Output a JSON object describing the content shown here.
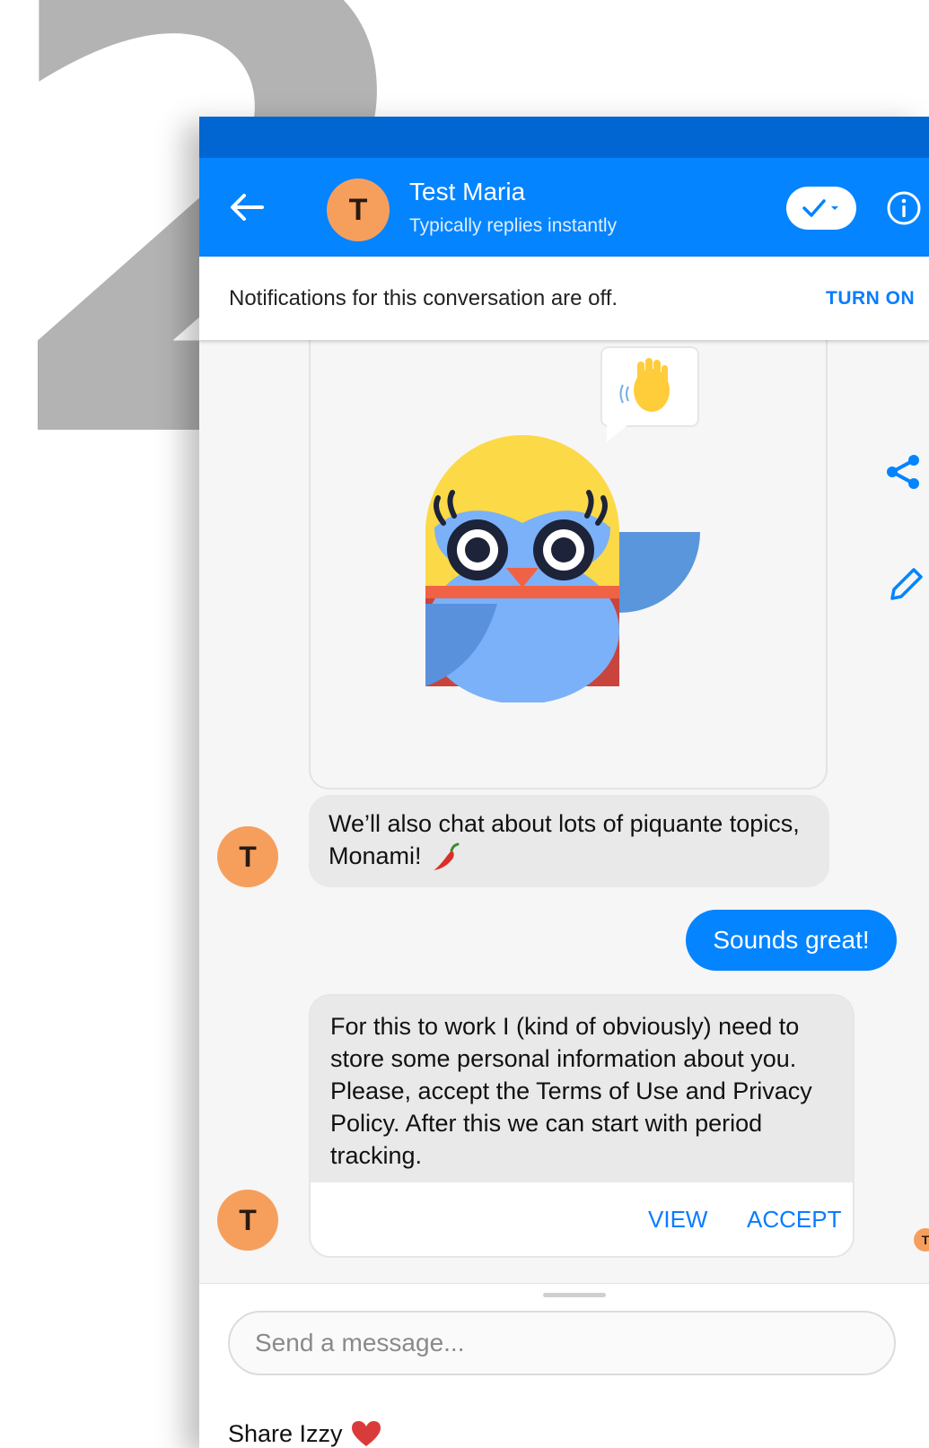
{
  "step_number": "2",
  "header": {
    "avatar_initial": "T",
    "title": "Test Maria",
    "subtitle": "Typically replies instantly"
  },
  "notification": {
    "text": "Notifications for this conversation are off.",
    "action": "TURN ON"
  },
  "messages": {
    "incoming_1": "We’ll also chat about lots of piquante topics, Monami!",
    "outgoing_1": "Sounds great!",
    "incoming_2": "For this to work I (kind of obviously) need to store some personal information about you. Please, accept the Terms of Use and Privacy Policy. After this we can start with period tracking.",
    "view_label": "VIEW",
    "accept_label": "ACCEPT",
    "avatar_initial": "T"
  },
  "composer": {
    "placeholder": "Send a message...",
    "share_label": "Share Izzy"
  },
  "colors": {
    "brand_blue": "#0484ff",
    "status_bar": "#0166d2",
    "avatar": "#f69f5d",
    "step_number": "#b3b3b3"
  },
  "icons": [
    "back-arrow-icon",
    "check-icon",
    "info-icon",
    "share-icon",
    "edit-icon",
    "waving-hand-icon",
    "chili-pepper-icon",
    "heart-icon"
  ]
}
